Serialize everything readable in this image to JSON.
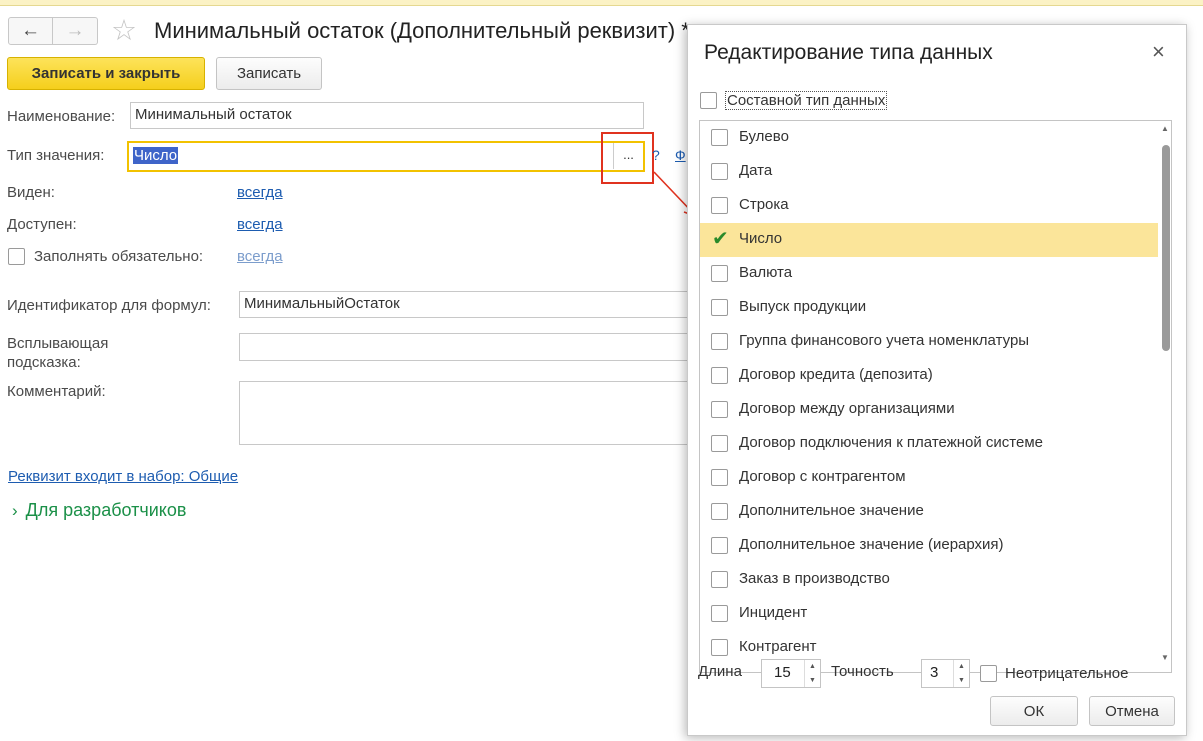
{
  "form": {
    "title": "Минимальный остаток (Дополнительный реквизит) *",
    "back_icon": "←",
    "forward_icon": "→",
    "favorite_icon": "☆",
    "save_close_label": "Записать и закрыть",
    "save_label": "Записать",
    "name_label": "Наименование:",
    "name_value": "Минимальный остаток",
    "type_label": "Тип значения:",
    "type_value": "Число",
    "type_select_button": "...",
    "help_mark": "?",
    "format_link": "Ф",
    "visible_label": "Виден:",
    "visible_value": "всегда",
    "available_label": "Доступен:",
    "available_value": "всегда",
    "required_label": "Заполнять обязательно:",
    "required_value": "всегда",
    "formula_id_label": "Идентификатор для формул:",
    "formula_id_value": "МинимальныйОстаток",
    "tooltip_label": "Всплывающая подсказка:",
    "comment_label": "Комментарий:",
    "set_link": "Реквизит входит в набор: Общие",
    "dev_group_label": "Для разработчиков",
    "dev_group_icon": "›"
  },
  "dialog": {
    "title": "Редактирование типа данных",
    "close_icon": "×",
    "composite_label": "Составной тип данных",
    "types": [
      {
        "label": "Булево",
        "checked": false
      },
      {
        "label": "Дата",
        "checked": false
      },
      {
        "label": "Строка",
        "checked": false
      },
      {
        "label": "Число",
        "checked": true
      },
      {
        "label": "Валюта",
        "checked": false
      },
      {
        "label": "Выпуск продукции",
        "checked": false
      },
      {
        "label": "Группа финансового учета номенклатуры",
        "checked": false
      },
      {
        "label": "Договор кредита (депозита)",
        "checked": false
      },
      {
        "label": "Договор между организациями",
        "checked": false
      },
      {
        "label": "Договор подключения к платежной системе",
        "checked": false
      },
      {
        "label": "Договор с контрагентом",
        "checked": false
      },
      {
        "label": "Дополнительное значение",
        "checked": false
      },
      {
        "label": "Дополнительное значение (иерархия)",
        "checked": false
      },
      {
        "label": "Заказ в производство",
        "checked": false
      },
      {
        "label": "Инцидент",
        "checked": false
      },
      {
        "label": "Контрагент",
        "checked": false
      }
    ],
    "check_icon": "✔",
    "length_label": "Длина",
    "length_value": "15",
    "precision_label": "Точность",
    "precision_value": "3",
    "nonnegative_label": "Неотрицательное",
    "ok_label": "ОК",
    "cancel_label": "Отмена",
    "spin_up_icon": "▲",
    "spin_down_icon": "▼"
  },
  "colors": {
    "accent_yellow": "#f5cf1c",
    "selection_row": "#fbe59a",
    "link_blue": "#1d5cb0",
    "highlight_red": "#e0321f",
    "dev_group_green": "#1b9048"
  }
}
